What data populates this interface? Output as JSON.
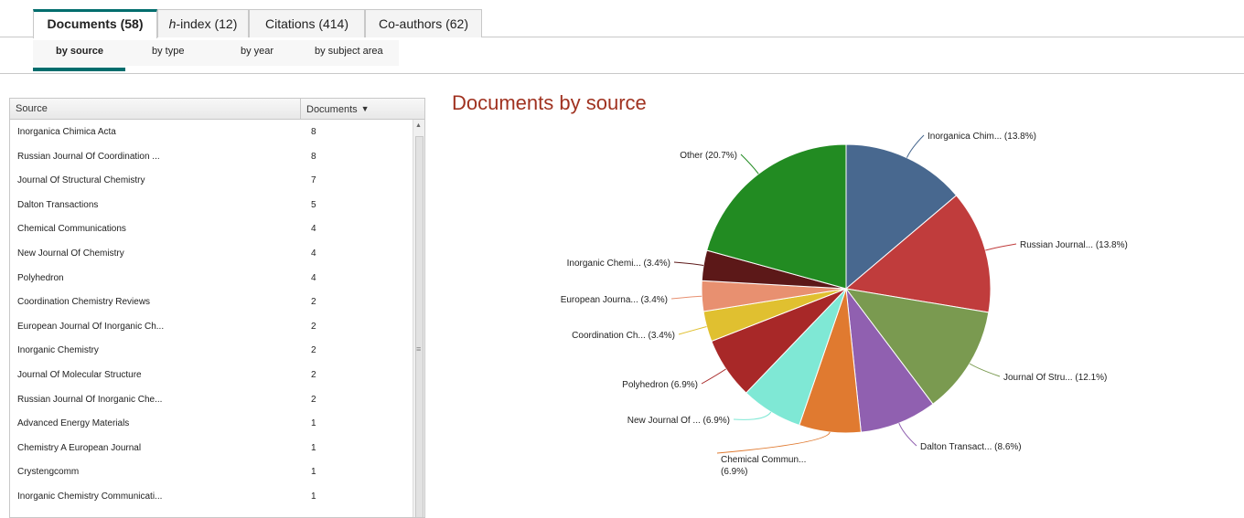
{
  "top_tabs": [
    {
      "label": "Documents (58)",
      "active": true
    },
    {
      "label_italic": "h",
      "label_rest": "-index (12)",
      "active": false
    },
    {
      "label": "Citations (414)",
      "active": false
    },
    {
      "label": "Co-authors (62)",
      "active": false
    }
  ],
  "sub_tabs": [
    {
      "label": "by source",
      "active": true
    },
    {
      "label": "by type",
      "active": false
    },
    {
      "label": "by year",
      "active": false
    },
    {
      "label": "by subject area",
      "active": false
    }
  ],
  "table": {
    "headers": {
      "source": "Source",
      "documents": "Documents"
    },
    "rows": [
      {
        "source": "Inorganica Chimica Acta",
        "documents": "8"
      },
      {
        "source": "Russian Journal Of Coordination ...",
        "documents": "8"
      },
      {
        "source": "Journal Of Structural Chemistry",
        "documents": "7"
      },
      {
        "source": "Dalton Transactions",
        "documents": "5"
      },
      {
        "source": "Chemical Communications",
        "documents": "4"
      },
      {
        "source": "New Journal Of Chemistry",
        "documents": "4"
      },
      {
        "source": "Polyhedron",
        "documents": "4"
      },
      {
        "source": "Coordination Chemistry Reviews",
        "documents": "2"
      },
      {
        "source": "European Journal Of Inorganic Ch...",
        "documents": "2"
      },
      {
        "source": "Inorganic Chemistry",
        "documents": "2"
      },
      {
        "source": "Journal Of Molecular Structure",
        "documents": "2"
      },
      {
        "source": "Russian Journal Of Inorganic Che...",
        "documents": "2"
      },
      {
        "source": "Advanced Energy Materials",
        "documents": "1"
      },
      {
        "source": "Chemistry A European Journal",
        "documents": "1"
      },
      {
        "source": "Crystengcomm",
        "documents": "1"
      },
      {
        "source": "Inorganic Chemistry Communicati...",
        "documents": "1"
      }
    ]
  },
  "chart_title": "Documents by source",
  "chart_data": {
    "type": "pie",
    "title": "Documents by source",
    "slices": [
      {
        "label": "Inorganica Chim... (13.8%)",
        "value": 13.8,
        "color": "#48688f"
      },
      {
        "label": "Russian Journal... (13.8%)",
        "value": 13.8,
        "color": "#c03c3c"
      },
      {
        "label": "Journal Of Stru... (12.1%)",
        "value": 12.1,
        "color": "#7a9a50"
      },
      {
        "label": "Dalton Transact... (8.6%)",
        "value": 8.6,
        "color": "#9060b0"
      },
      {
        "label": "Chemical Commun... (6.9%)",
        "value": 6.9,
        "color": "#e07a30"
      },
      {
        "label": "New Journal Of ... (6.9%)",
        "value": 6.9,
        "color": "#7fe8d5"
      },
      {
        "label": "Polyhedron (6.9%)",
        "value": 6.9,
        "color": "#a82828"
      },
      {
        "label": "Coordination Ch... (3.4%)",
        "value": 3.4,
        "color": "#e0c030"
      },
      {
        "label": "European Journa... (3.4%)",
        "value": 3.4,
        "color": "#e89070"
      },
      {
        "label": "Inorganic Chemi... (3.4%)",
        "value": 3.4,
        "color": "#5c1818"
      },
      {
        "label": "Other (20.7%)",
        "value": 20.7,
        "color": "#228b22"
      }
    ]
  }
}
